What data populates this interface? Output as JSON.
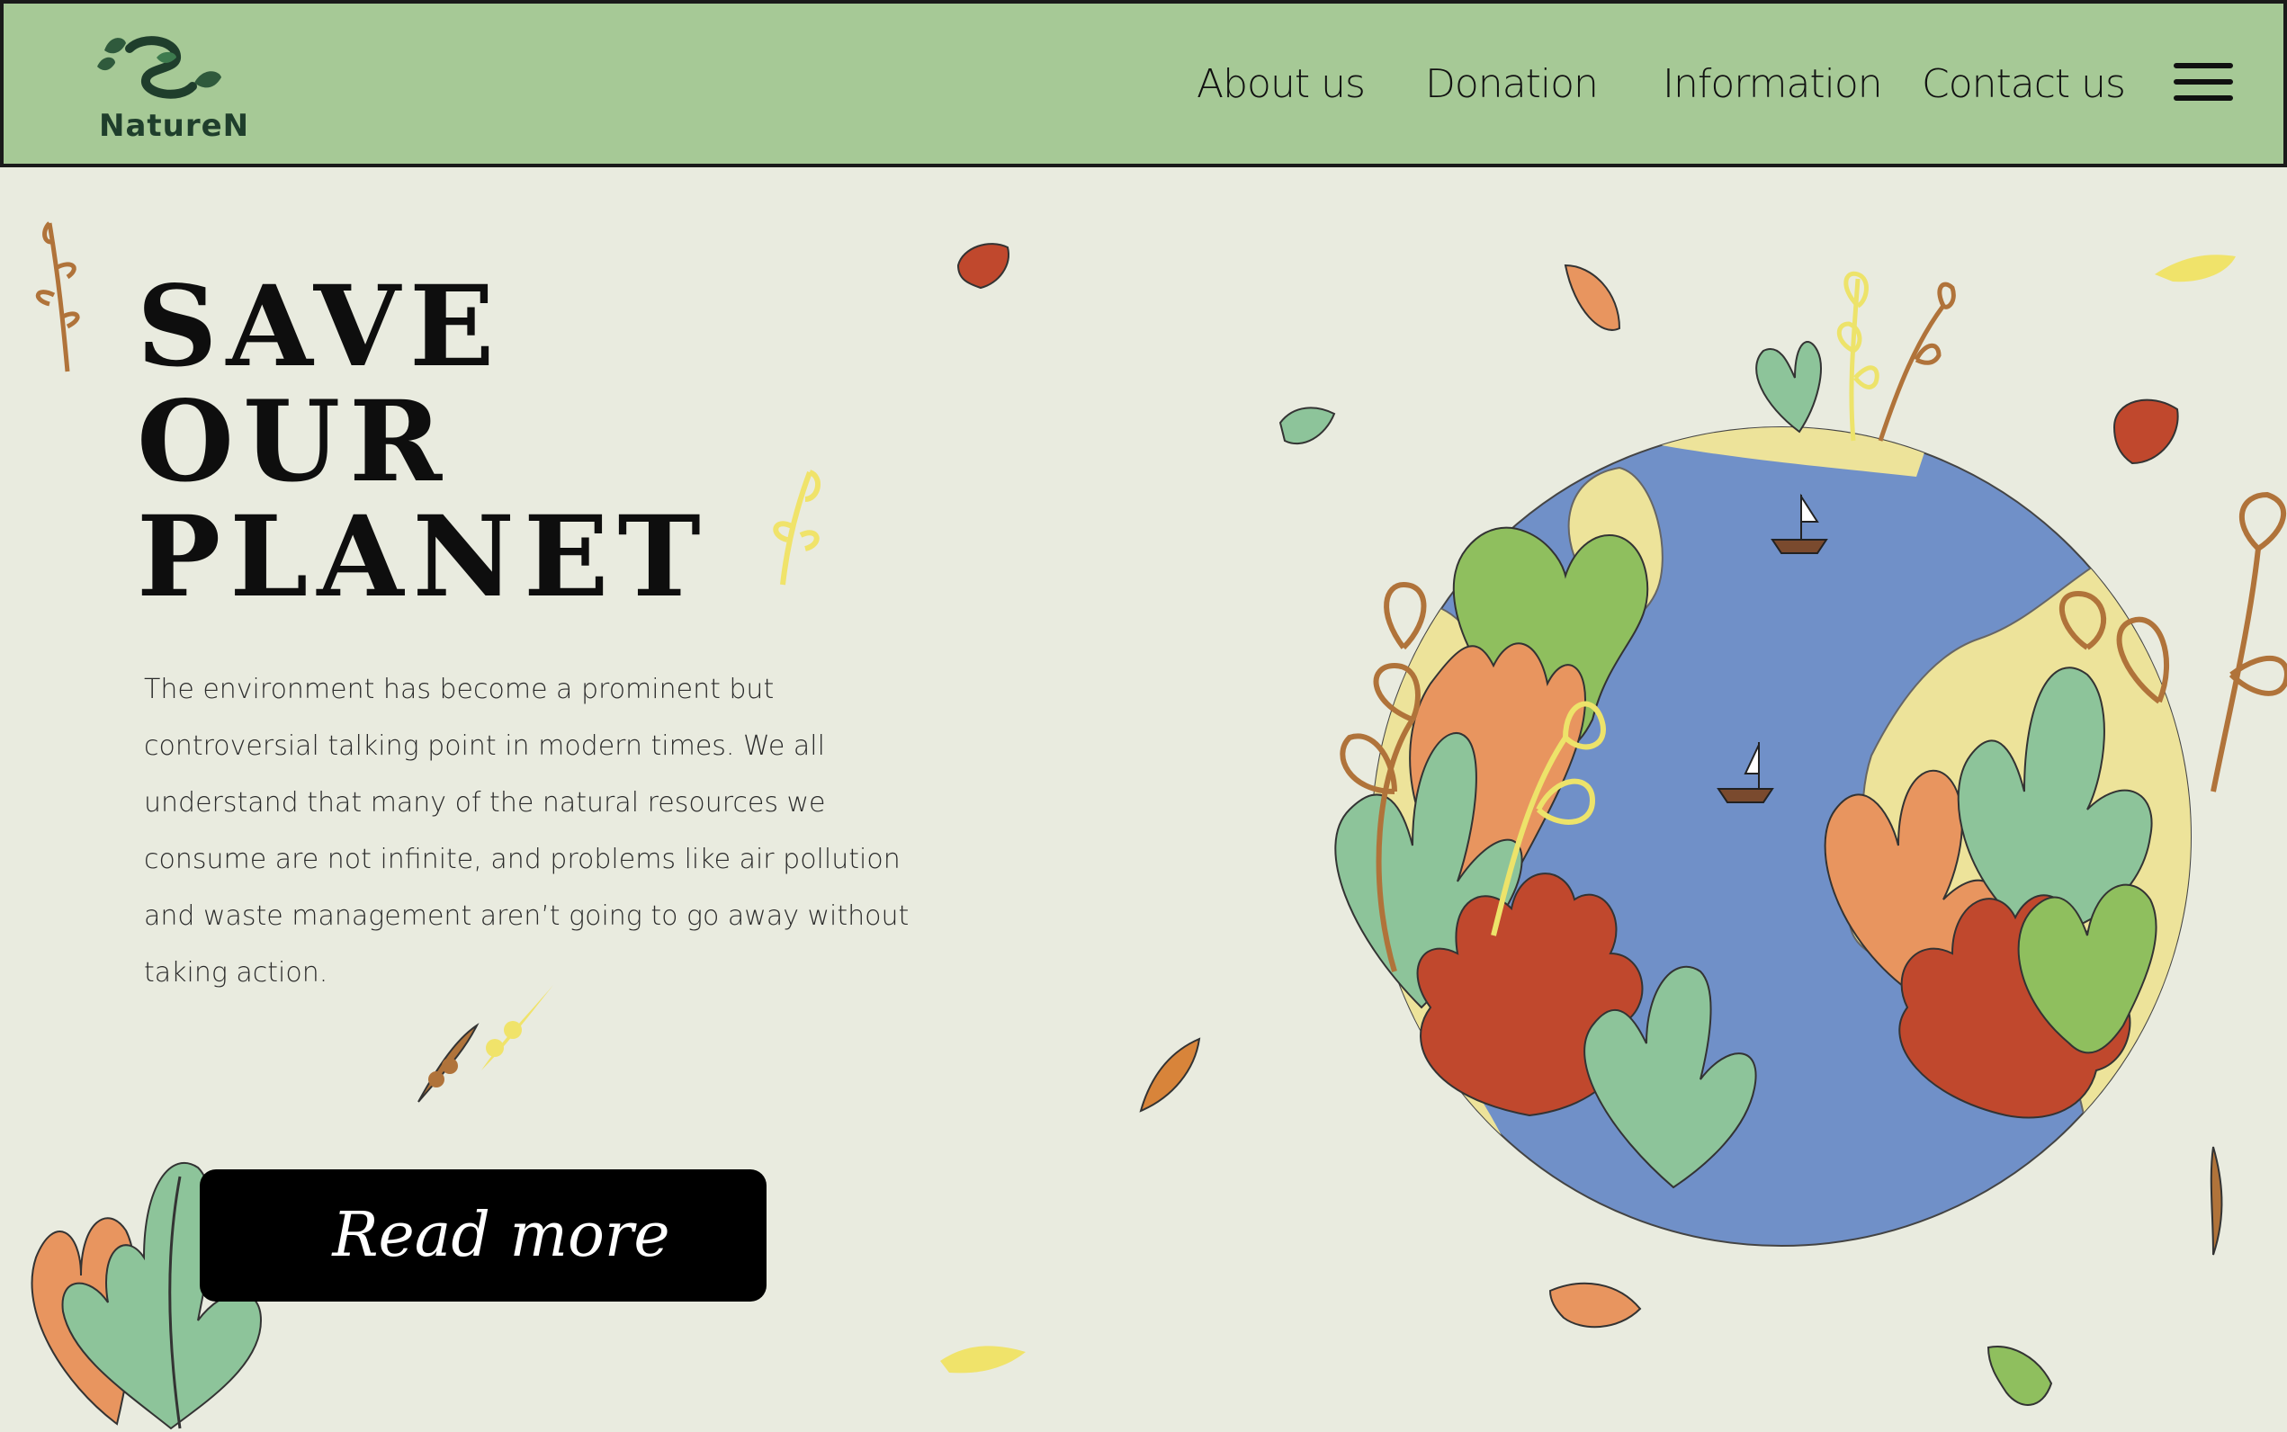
{
  "brand": {
    "name": "NatureN"
  },
  "nav": {
    "items": [
      {
        "label": "About us"
      },
      {
        "label": "Donation"
      },
      {
        "label": "Information"
      },
      {
        "label": "Contact us"
      }
    ],
    "menu_icon": "hamburger-menu-icon"
  },
  "hero": {
    "title_lines": [
      "SAVE",
      "OUR",
      "PLANET"
    ],
    "description": "The environment has become a prominent but controversial talking point in modern times. We all understand that many of the natural resources we consume are not infinite, and problems like air pollution and waste management aren’t going to go away without taking action.",
    "cta_label": "Read more"
  },
  "illustration": {
    "subject": "earth-globe-with-leaves",
    "colors": {
      "ocean": "#7090c8",
      "land": "#ede39a",
      "leaf_green": "#8dc49a",
      "leaf_lime": "#8fbf5e",
      "leaf_orange": "#e8955f",
      "leaf_red": "#c0482d",
      "leaf_brown": "#b0733a",
      "leaf_yellow": "#f0e36a"
    }
  },
  "colors": {
    "navbar_bg": "#a6c996",
    "page_bg": "#e9ebdf",
    "button_bg": "#000000",
    "text": "#111111"
  }
}
